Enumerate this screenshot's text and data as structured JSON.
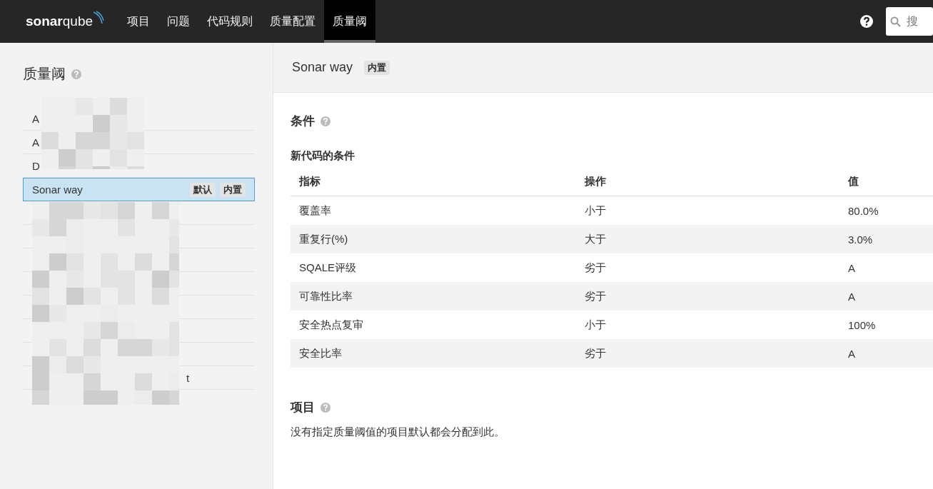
{
  "nav": {
    "logo": {
      "brand": "sonar",
      "suffix": "qube"
    },
    "items": [
      {
        "label": "项目",
        "selected": false
      },
      {
        "label": "问题",
        "selected": false
      },
      {
        "label": "代码规则",
        "selected": false
      },
      {
        "label": "质量配置",
        "selected": false
      },
      {
        "label": "质量阈",
        "selected": true
      }
    ],
    "search": {
      "placeholder": "搜"
    }
  },
  "sidebar": {
    "title": "质量阈",
    "items": [
      {
        "label": "A",
        "selected": false
      },
      {
        "label": "A",
        "selected": false
      },
      {
        "label": "D",
        "selected": false
      },
      {
        "label": "Sonar way",
        "selected": true,
        "tags": [
          "默认",
          "内置"
        ]
      },
      {
        "selected": false
      },
      {
        "selected": false
      },
      {
        "selected": false
      },
      {
        "selected": false
      },
      {
        "selected": false
      },
      {
        "selected": false
      },
      {
        "selected": false
      },
      {
        "label": "t",
        "selected": false
      }
    ]
  },
  "detail": {
    "title": "Sonar way",
    "tag": "内置",
    "conditions": {
      "title": "条件",
      "subtitle": "新代码的条件",
      "columns": [
        "指标",
        "操作",
        "值"
      ],
      "rows": [
        [
          "覆盖率",
          "小于",
          "80.0%"
        ],
        [
          "重复行(%)",
          "大于",
          "3.0%"
        ],
        [
          "SQALE评级",
          "劣于",
          "A"
        ],
        [
          "可靠性比率",
          "劣于",
          "A"
        ],
        [
          "安全热点复审",
          "小于",
          "100%"
        ],
        [
          "安全比率",
          "劣于",
          "A"
        ]
      ]
    },
    "projects": {
      "title": "项目",
      "text": "没有指定质量阈值的项目默认都会分配到此。"
    }
  }
}
